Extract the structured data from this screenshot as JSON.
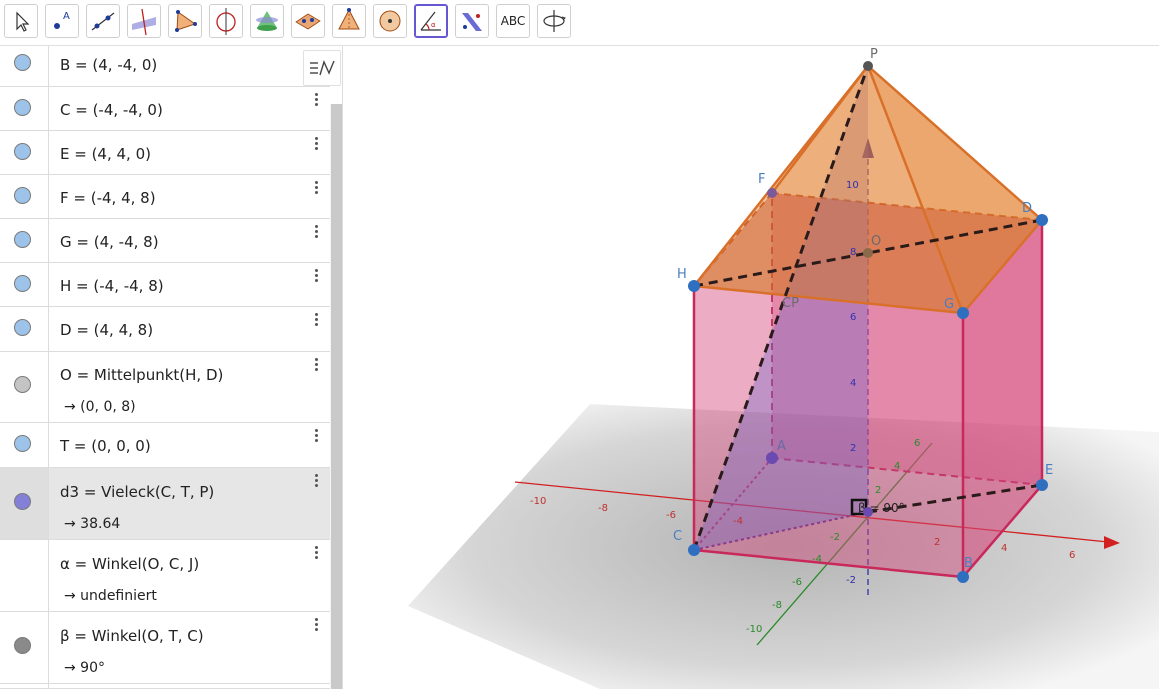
{
  "toolbar": {
    "tools": [
      {
        "name": "move-tool-icon"
      },
      {
        "name": "point-tool-icon"
      },
      {
        "name": "line-tool-icon"
      },
      {
        "name": "perpendicular-line-tool-icon"
      },
      {
        "name": "polygon-tool-icon"
      },
      {
        "name": "circle-axis-tool-icon"
      },
      {
        "name": "plane-tool-icon"
      },
      {
        "name": "plane-through-points-tool-icon"
      },
      {
        "name": "pyramid-tool-icon"
      },
      {
        "name": "sphere-tool-icon"
      },
      {
        "name": "angle-tool-icon",
        "active": true
      },
      {
        "name": "reflect-tool-icon"
      },
      {
        "name": "text-tool-icon",
        "text": "ABC"
      },
      {
        "name": "rotate-view-tool-icon"
      }
    ]
  },
  "algebra": {
    "rows": [
      {
        "def": "B = (4, -4, 0)",
        "color": "#9dc3ea"
      },
      {
        "def": "C = (-4, -4, 0)",
        "color": "#9dc3ea"
      },
      {
        "def": "E = (4, 4, 0)",
        "color": "#9dc3ea"
      },
      {
        "def": "F = (-4, 4, 8)",
        "color": "#9dc3ea"
      },
      {
        "def": "G = (4, -4, 8)",
        "color": "#9dc3ea"
      },
      {
        "def": "H = (-4, -4, 8)",
        "color": "#9dc3ea"
      },
      {
        "def": "D = (4, 4, 8)",
        "color": "#9dc3ea"
      },
      {
        "def": "O = Mittelpunkt(H, D)",
        "out": "→  (0, 0, 8)",
        "color": "#c4c4c4"
      },
      {
        "def": "T = (0, 0, 0)",
        "color": "#9dc3ea"
      },
      {
        "def": "d3 = Vieleck(C, T, P)",
        "out": "→  38.64",
        "color": "#8480d8",
        "selected": true
      },
      {
        "def": "α = Winkel(O, C, J)",
        "out": "→  undefiniert",
        "color": "none"
      },
      {
        "def": "β = Winkel(O, T, C)",
        "out": "→  90°",
        "color": "#8a8a8a"
      }
    ]
  },
  "graphics": {
    "point_labels": {
      "P": "P",
      "F": "F",
      "D": "D",
      "H": "H",
      "O": "O",
      "CP": "CP",
      "G": "G",
      "A": "A",
      "E": "E",
      "C": "C",
      "B": "B"
    },
    "angle_label": "β = 90°",
    "x_ticks": [
      "-10",
      "-8",
      "-6",
      "-4",
      "2",
      "4",
      "6"
    ],
    "z_ticks": [
      "10",
      "8",
      "6",
      "4",
      "2",
      "-2"
    ],
    "y_ticks": [
      "6",
      "4",
      "2",
      "-2",
      "-4",
      "-6",
      "-8",
      "-10"
    ],
    "colors": {
      "prism": "#d5477a",
      "roof": "#e27f2a",
      "x_axis": "#d22020",
      "y_axis": "#2a8a2a",
      "z_axis": "#3030b0",
      "point": "#2f6fbf"
    }
  }
}
